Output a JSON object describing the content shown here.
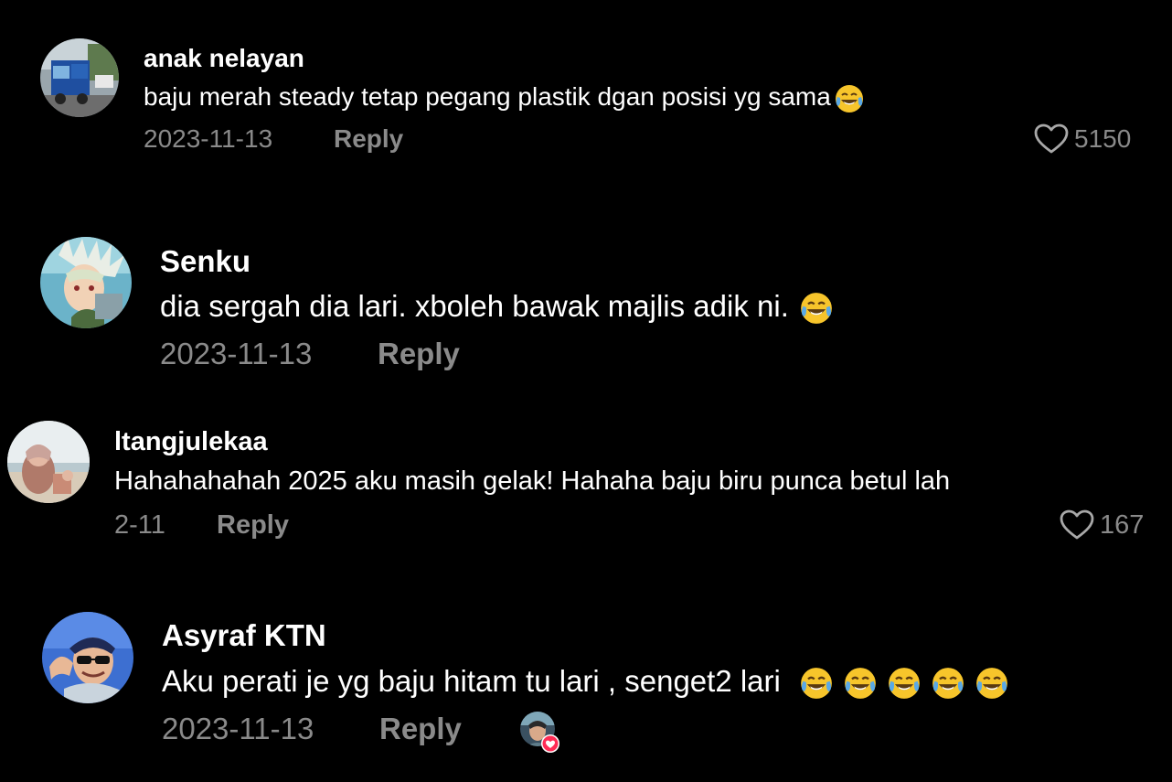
{
  "comments": [
    {
      "username": "anak nelayan",
      "text": "baju merah steady tetap pegang plastik dgan posisi yg sama",
      "emoji": [
        "tears-of-joy"
      ],
      "date": "2023-11-13",
      "reply_label": "Reply",
      "likes": "5150"
    },
    {
      "username": "Senku",
      "text": "dia sergah dia lari. xboleh bawak majlis adik ni.",
      "emoji": [
        "tears-of-joy"
      ],
      "date": "2023-11-13",
      "reply_label": "Reply"
    },
    {
      "username": "ltangjulekaa",
      "text": "Hahahahahah 2025 aku masih gelak! Hahaha baju biru punca betul lah",
      "date": "2-11",
      "reply_label": "Reply",
      "likes": "167"
    },
    {
      "username": "Asyraf KTN",
      "text": "Aku perati je yg baju hitam tu lari , senget2 lari",
      "emoji": [
        "tears-of-joy",
        "tears-of-joy",
        "tears-of-joy",
        "tears-of-joy",
        "tears-of-joy"
      ],
      "date": "2023-11-13",
      "reply_label": "Reply",
      "creator_liked": true
    }
  ],
  "colors": {
    "background": "#000000",
    "primary_text": "#ffffff",
    "secondary_text": "#8a8a8a",
    "emoji_face": "#f7c52b",
    "tears": "#5aa9e6",
    "heart_badge": "#fe2c55"
  },
  "icons": {
    "like": "heart-outline-icon",
    "emoji": "face-with-tears-of-joy",
    "creator_badge": "red-heart-badge"
  }
}
